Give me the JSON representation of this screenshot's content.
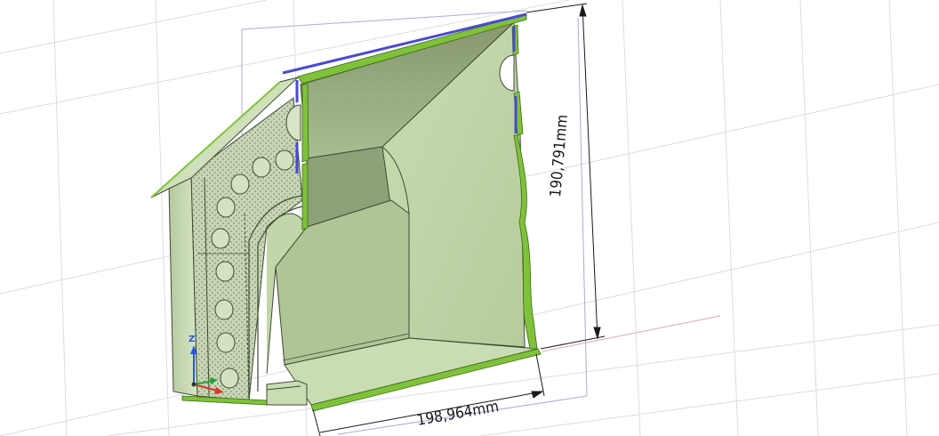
{
  "viewport": {
    "background": "#ffffff",
    "grid_color": "#d9dde8",
    "model_fill": "#c5dbab",
    "model_outline": "#3f4a35",
    "section_color": "#7fc23a",
    "edge_highlight": "#4a4ad0",
    "dimension_color": "#1a1a1a"
  },
  "dimensions": {
    "height_label": "190,791mm",
    "width_label": "198,964mm"
  },
  "triad": {
    "z_label": "Z",
    "z_color": "#2a55d8",
    "x_color": "#d83a2a",
    "y_color": "#2aa03a"
  }
}
